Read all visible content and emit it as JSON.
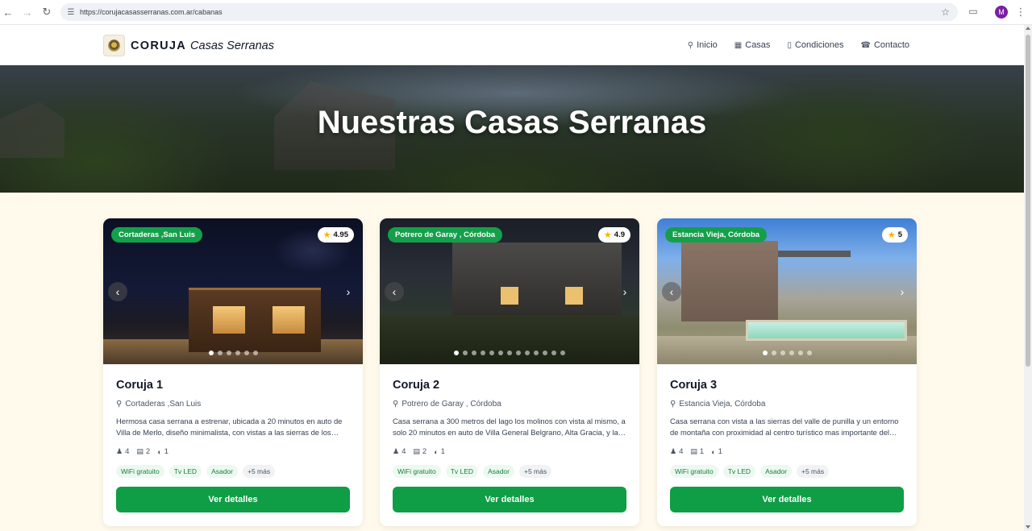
{
  "browser": {
    "url": "https://corujacasasserranas.com.ar/cabanas",
    "avatar_letter": "M"
  },
  "brand": {
    "name": "CORUJA",
    "sub": "Casas Serranas"
  },
  "nav": [
    {
      "label": "Inicio",
      "icon": "map-pin-icon"
    },
    {
      "label": "Casas",
      "icon": "building-icon"
    },
    {
      "label": "Condiciones",
      "icon": "document-icon"
    },
    {
      "label": "Contacto",
      "icon": "phone-icon"
    }
  ],
  "hero": {
    "title": "Nuestras Casas Serranas"
  },
  "accent_color": "#0f9d45",
  "cards": [
    {
      "location_badge": "Cortaderas ,San Luis",
      "rating": "4.95",
      "title": "Coruja 1",
      "location": "Cortaderas ,San Luis",
      "description": "Hermosa casa serrana a estrenar, ubicada a 20 minutos en auto de Villa de Merlo, diseño minimalista, con vistas a las sierras de los…",
      "guests": "4",
      "beds": "2",
      "baths": "1",
      "tags": [
        "WiFi gratuito",
        "Tv LED",
        "Asador"
      ],
      "more": "+5 más",
      "button": "Ver detalles",
      "image_count": 6,
      "active_image": 0
    },
    {
      "location_badge": "Potrero de Garay , Córdoba",
      "rating": "4.9",
      "title": "Coruja 2",
      "location": "Potrero de Garay , Córdoba",
      "description": "Casa serrana a 300 metros del lago los molinos con vista al mismo, a solo 20 minutos en auto de Villa General Belgrano, Alta Gracia, y la…",
      "guests": "4",
      "beds": "2",
      "baths": "1",
      "tags": [
        "WiFi gratuito",
        "Tv LED",
        "Asador"
      ],
      "more": "+5 más",
      "button": "Ver detalles",
      "image_count": 13,
      "active_image": 0
    },
    {
      "location_badge": "Estancia Vieja, Córdoba",
      "rating": "5",
      "title": "Coruja 3",
      "location": "Estancia Vieja, Córdoba",
      "description": "Casa serrana con vista a las sierras del valle de punilla y un entorno de montaña con proximidad al centro turístico mas importante del…",
      "guests": "4",
      "beds": "1",
      "baths": "1",
      "tags": [
        "WiFi gratuito",
        "Tv LED",
        "Asador"
      ],
      "more": "+5 más",
      "button": "Ver detalles",
      "image_count": 6,
      "active_image": 0
    }
  ]
}
